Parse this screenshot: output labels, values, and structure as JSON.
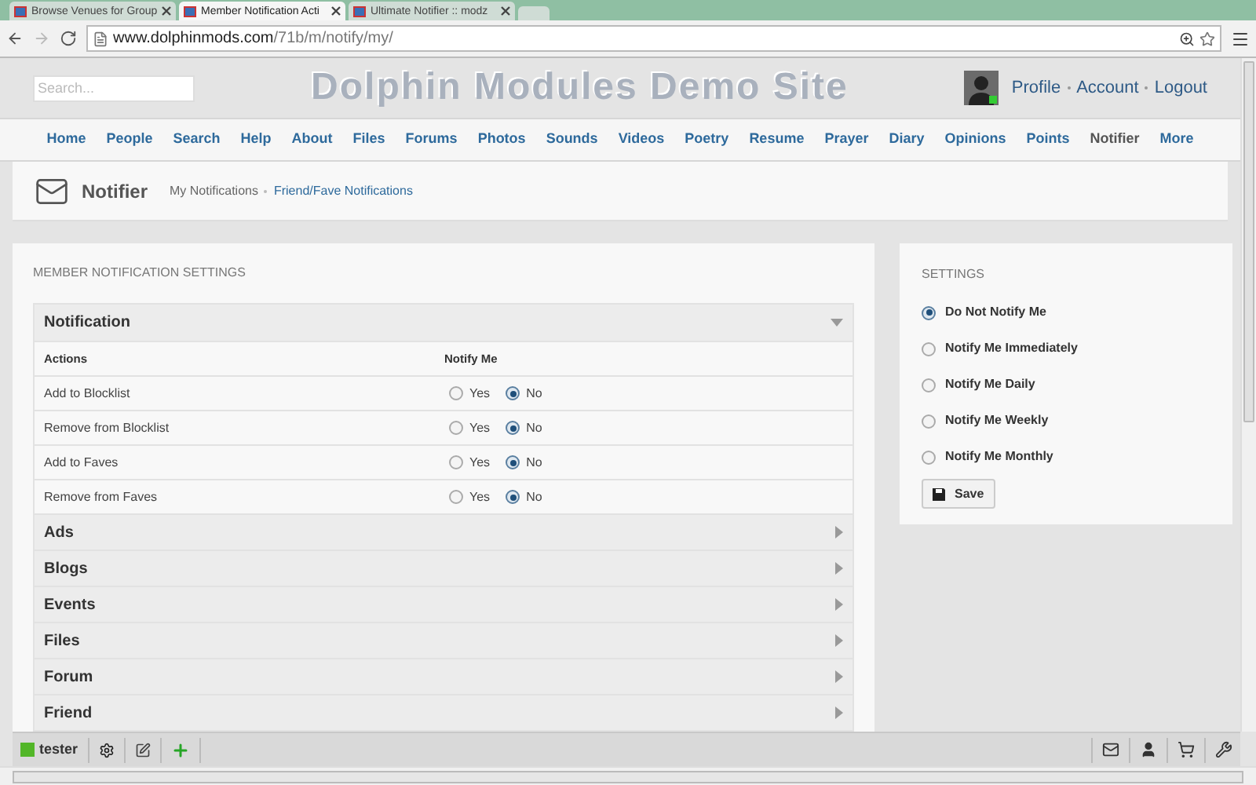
{
  "browser": {
    "tabs": [
      {
        "title": "Browse Venues for Group",
        "selected": false
      },
      {
        "title": "Member Notification Acti",
        "selected": true
      },
      {
        "title": "Ultimate Notifier :: modz",
        "selected": false
      }
    ],
    "url_host": "www.dolphinmods.com",
    "url_path": "/71b/m/notify/my/"
  },
  "header": {
    "search": {
      "placeholder": "Search..."
    },
    "site_title": "Dolphin Modules Demo Site",
    "user_links": [
      "Profile",
      "Account",
      "Logout"
    ]
  },
  "nav": [
    {
      "label": "Home",
      "selected": false
    },
    {
      "label": "People",
      "selected": false
    },
    {
      "label": "Search",
      "selected": false
    },
    {
      "label": "Help",
      "selected": false
    },
    {
      "label": "About",
      "selected": false
    },
    {
      "label": "Files",
      "selected": false
    },
    {
      "label": "Forums",
      "selected": false
    },
    {
      "label": "Photos",
      "selected": false
    },
    {
      "label": "Sounds",
      "selected": false
    },
    {
      "label": "Videos",
      "selected": false
    },
    {
      "label": "Poetry",
      "selected": false
    },
    {
      "label": "Resume",
      "selected": false
    },
    {
      "label": "Prayer",
      "selected": false
    },
    {
      "label": "Diary",
      "selected": false
    },
    {
      "label": "Opinions",
      "selected": false
    },
    {
      "label": "Points",
      "selected": false
    },
    {
      "label": "Notifier",
      "selected": true
    },
    {
      "label": "More",
      "selected": false
    }
  ],
  "page_header": {
    "title": "Notifier",
    "links": [
      {
        "label": "My Notifications",
        "selected": true
      },
      {
        "label": "Friend/Fave Notifications",
        "selected": false
      }
    ]
  },
  "member_settings": {
    "heading": "MEMBER NOTIFICATION SETTINGS",
    "sections": [
      {
        "title": "Notification",
        "expanded": true,
        "columns": [
          "Actions",
          "Notify Me"
        ],
        "rows": [
          {
            "action": "Add to Blocklist",
            "options": [
              {
                "label": "Yes",
                "selected": false
              },
              {
                "label": "No",
                "selected": true
              }
            ]
          },
          {
            "action": "Remove from Blocklist",
            "options": [
              {
                "label": "Yes",
                "selected": false
              },
              {
                "label": "No",
                "selected": true
              }
            ]
          },
          {
            "action": "Add to Faves",
            "options": [
              {
                "label": "Yes",
                "selected": false
              },
              {
                "label": "No",
                "selected": true
              }
            ]
          },
          {
            "action": "Remove from Faves",
            "options": [
              {
                "label": "Yes",
                "selected": false
              },
              {
                "label": "No",
                "selected": true
              }
            ]
          }
        ]
      },
      {
        "title": "Ads",
        "expanded": false
      },
      {
        "title": "Blogs",
        "expanded": false
      },
      {
        "title": "Events",
        "expanded": false
      },
      {
        "title": "Files",
        "expanded": false
      },
      {
        "title": "Forum",
        "expanded": false
      },
      {
        "title": "Friend",
        "expanded": false
      }
    ]
  },
  "settings": {
    "heading": "SETTINGS",
    "options": [
      {
        "label": "Do Not Notify Me",
        "selected": true
      },
      {
        "label": "Notify Me Immediately",
        "selected": false
      },
      {
        "label": "Notify Me Daily",
        "selected": false
      },
      {
        "label": "Notify Me Weekly",
        "selected": false
      },
      {
        "label": "Notify Me Monthly",
        "selected": false
      }
    ],
    "save_button": "Save"
  },
  "toolbar": {
    "username": "tester"
  }
}
